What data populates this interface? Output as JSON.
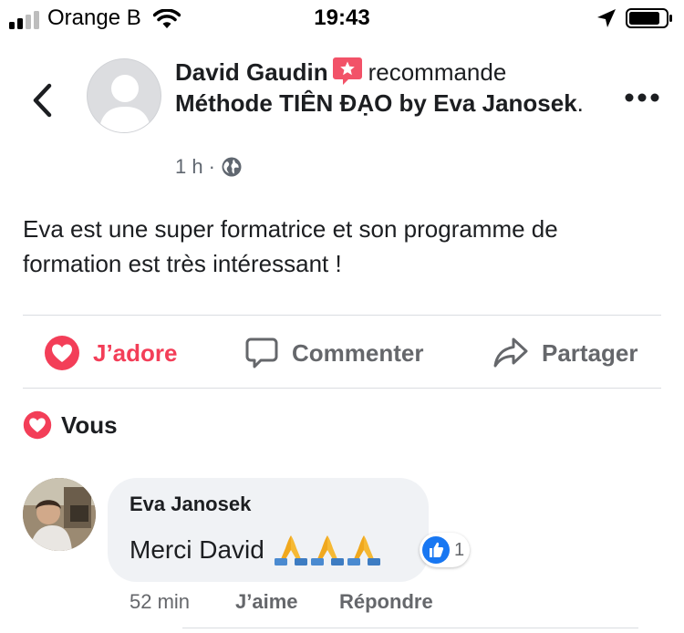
{
  "status_bar": {
    "carrier": "Orange B",
    "time": "19:43"
  },
  "post": {
    "author": "David Gaudin",
    "verb": "recommande",
    "page_name": "Méthode TIÊN ĐẠO by Eva Janosek",
    "trailing": ".",
    "time": "1 h",
    "separator": "·",
    "text": "Eva est une super formatrice et son programme de formation est très intéressant !"
  },
  "actions": {
    "love_label": "J’adore",
    "comment_label": "Commenter",
    "share_label": "Partager"
  },
  "reactions_summary": {
    "label": "Vous"
  },
  "comment": {
    "author": "Eva Janosek",
    "text": "Merci David",
    "emoji_count": 3,
    "reaction_count": "1",
    "time": "52 min",
    "like_label": "J’aime",
    "reply_label": "Répondre"
  },
  "colors": {
    "love": "#f33e58",
    "like": "#1877f2",
    "recommend_badge": "#f25268",
    "secondary_text": "#65676b"
  }
}
